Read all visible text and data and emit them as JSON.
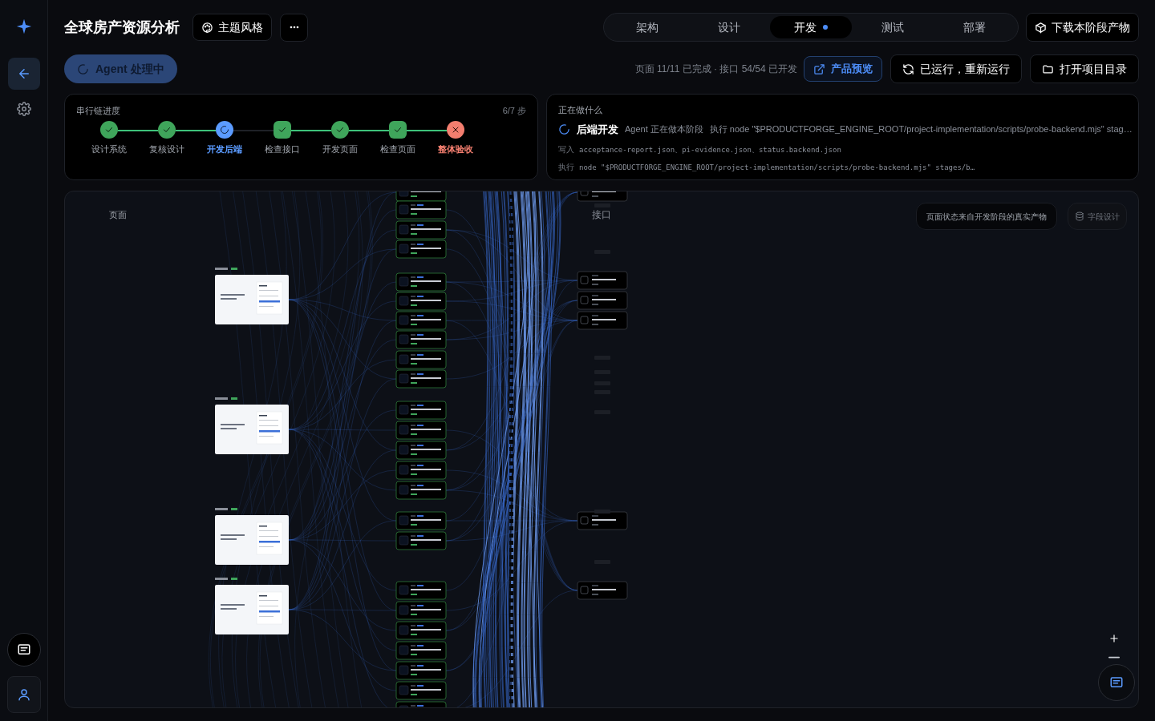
{
  "sidebar": {
    "items": [
      {
        "kind": "back",
        "selected": true
      },
      {
        "kind": "settings",
        "selected": false
      }
    ]
  },
  "header": {
    "title": "全球房产资源分析",
    "theme_button": "主题风格"
  },
  "stage_tabs": [
    {
      "label": "架构",
      "selected": false,
      "dot": false
    },
    {
      "label": "设计",
      "selected": false,
      "dot": false
    },
    {
      "label": "开发",
      "selected": true,
      "dot": true
    },
    {
      "label": "测试",
      "selected": false,
      "dot": false
    },
    {
      "label": "部署",
      "selected": false,
      "dot": false
    }
  ],
  "download_button": "下载本阶段产物",
  "agent_status": "Agent 处理中",
  "summary": "页面 11/11 已完成 · 接口 54/54 已开发",
  "actions": [
    {
      "label": "产品预览",
      "kind": "preview"
    },
    {
      "label": "已运行，重新运行",
      "kind": "rerun"
    },
    {
      "label": "打开项目目录",
      "kind": "folder"
    }
  ],
  "progress": {
    "title": "串行链进度",
    "count": "6/7 步",
    "steps": [
      {
        "label": "设计系统",
        "kind": "done",
        "square": false
      },
      {
        "label": "复核设计",
        "kind": "done",
        "square": false
      },
      {
        "label": "开发后端",
        "kind": "running",
        "square": false
      },
      {
        "label": "检查接口",
        "kind": "done",
        "square": true
      },
      {
        "label": "开发页面",
        "kind": "done",
        "square": false
      },
      {
        "label": "检查页面",
        "kind": "done",
        "square": true
      },
      {
        "label": "整体验收",
        "kind": "failed",
        "square": false
      }
    ]
  },
  "activity": {
    "title": "正在做什么",
    "stage": "后端开发",
    "message": "Agent 正在做本阶段",
    "command": "执行 node \"$PRODUCTFORGE_ENGINE_ROOT/project-implementation/scripts/probe-backend.mjs\" stag…",
    "lines": [
      {
        "label": "写入",
        "text": "acceptance-report.json、pi-evidence.json、status.backend.json"
      },
      {
        "label": "执行",
        "text": "node \"$PRODUCTFORGE_ENGINE_ROOT/project-implementation/scripts/probe-backend.mjs\" stages/b…"
      }
    ]
  },
  "canvas": {
    "pages_label": "页面",
    "apis_label": "接口",
    "note": "页面状态来自开发阶段的真实产物",
    "field_design_button": "字段设计"
  }
}
